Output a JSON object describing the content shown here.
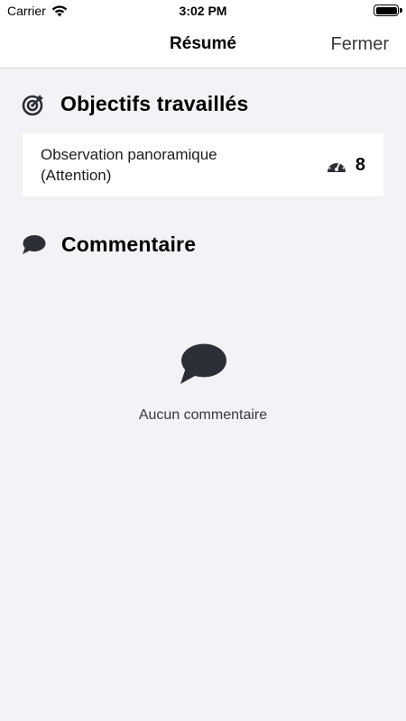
{
  "status_bar": {
    "carrier": "Carrier",
    "time": "3:02 PM",
    "icons": [
      "wifi-icon",
      "battery-icon"
    ]
  },
  "nav": {
    "title": "Résumé",
    "close_label": "Fermer"
  },
  "objectives": {
    "header_icon": "target-icon",
    "title": "Objectifs travaillés",
    "items": [
      {
        "label": "Observation panoramique (Attention)",
        "icon": "speedometer-icon",
        "value": "8"
      }
    ]
  },
  "comments": {
    "header_icon": "comment-bubble-icon",
    "title": "Commentaire",
    "empty_icon": "comment-bubble-icon",
    "empty_text": "Aucun commentaire"
  },
  "colors": {
    "background": "#f2f2f7",
    "card": "#ffffff",
    "icon": "#2c2f36"
  }
}
